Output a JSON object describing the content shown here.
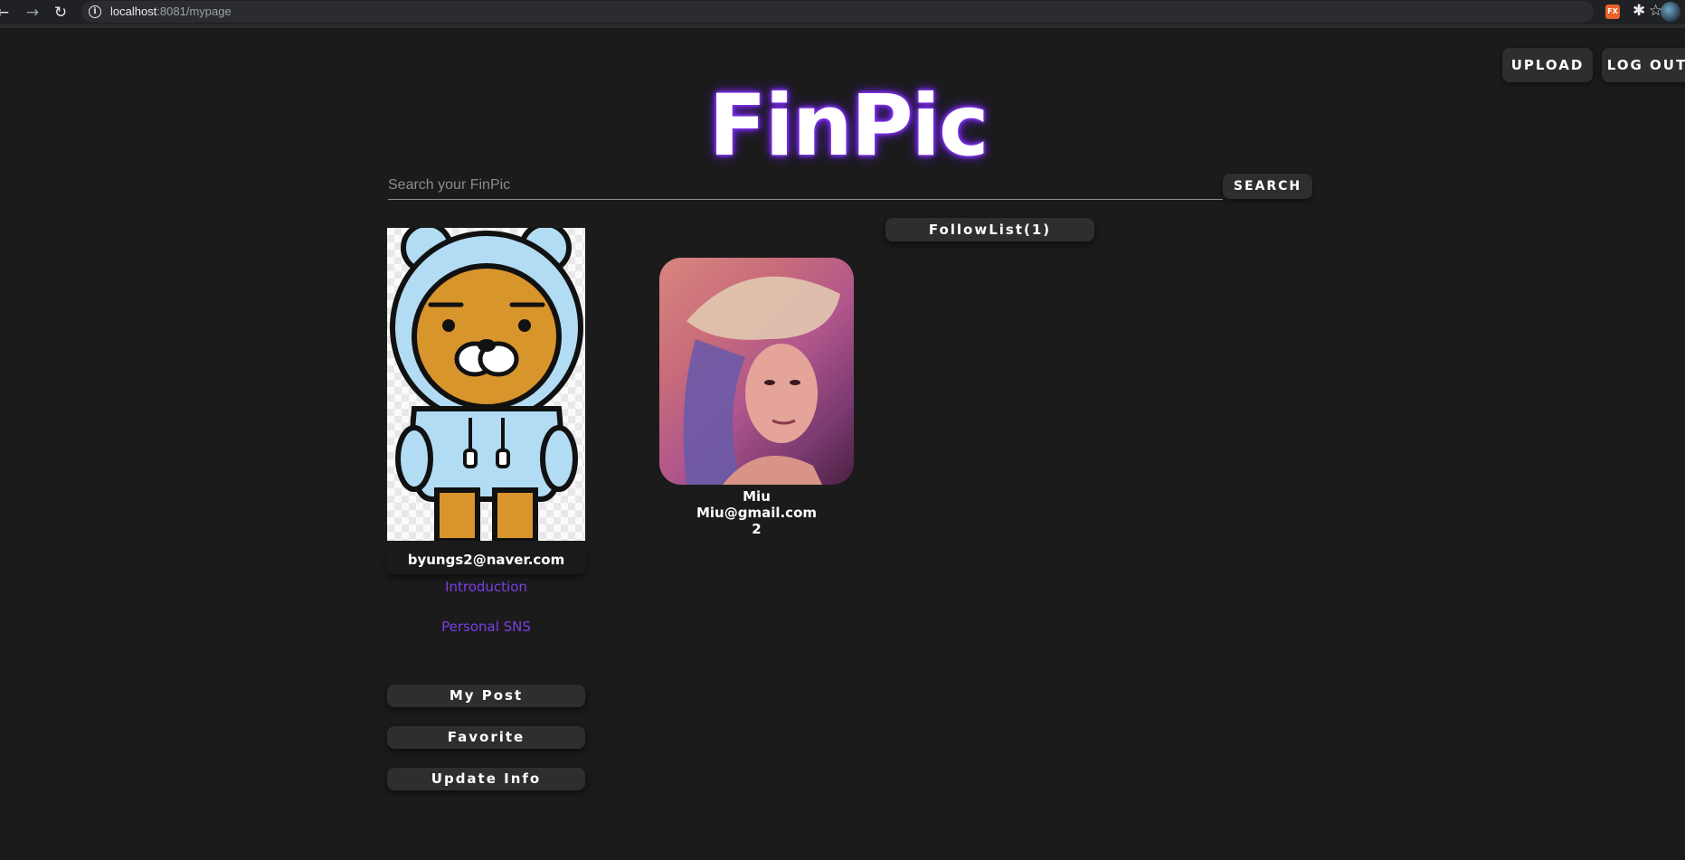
{
  "browser": {
    "url_host": "localhost",
    "url_rest": ":8081/mypage",
    "ext_fx_label": "FX"
  },
  "header": {
    "upload_label": "UPLOAD",
    "logout_label": "LOG OUT",
    "logo_text": "FinPic"
  },
  "search": {
    "placeholder": "Search your FinPic",
    "value": "",
    "button_label": "SEARCH"
  },
  "profile": {
    "email": "byungs2@naver.com",
    "introduction_label": "Introduction",
    "sns_label": "Personal SNS",
    "buttons": {
      "my_post": "My Post",
      "favorite": "Favorite",
      "update_info": "Update Info"
    },
    "colors": {
      "link": "#7b3fe4",
      "accent_glow": "#7b2cf0"
    }
  },
  "follow": {
    "title": "FollowList(1)",
    "items": [
      {
        "name": "Miu",
        "email": "Miu@gmail.com",
        "count": "2"
      }
    ]
  }
}
